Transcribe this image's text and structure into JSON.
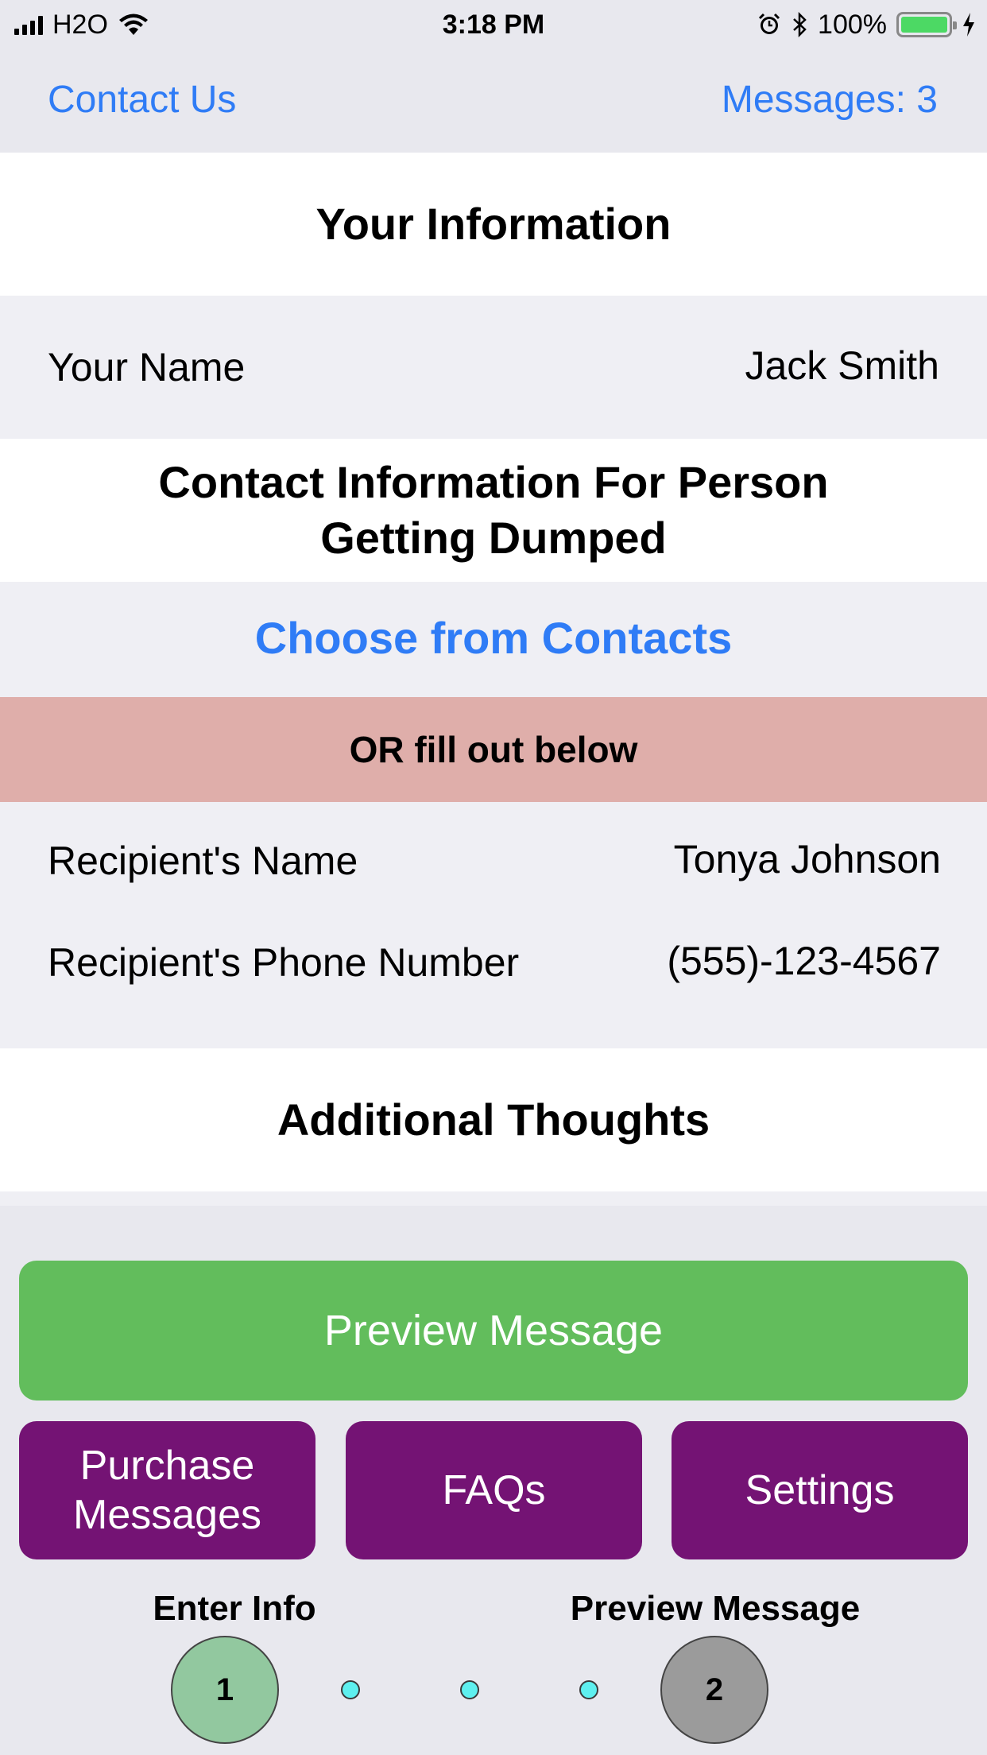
{
  "status_bar": {
    "carrier": "H2O",
    "time": "3:18 PM",
    "battery": "100%",
    "icons": [
      "signal-icon",
      "wifi-icon",
      "alarm-icon",
      "bluetooth-icon",
      "battery-icon",
      "charging-icon"
    ]
  },
  "nav": {
    "left_label": "Contact Us",
    "right_label": "Messages: 3"
  },
  "your_info": {
    "header": "Your Information",
    "name_label": "Your Name",
    "name_value": "Jack Smith"
  },
  "contact_info": {
    "header_line1": "Contact Information For Person",
    "header_line2": "Getting Dumped",
    "choose_label": "Choose from Contacts",
    "or_label": "OR fill out below",
    "recipient_name_label": "Recipient's Name",
    "recipient_name_value": "Tonya Johnson",
    "recipient_phone_label": "Recipient's Phone Number",
    "recipient_phone_value": "(555)-123-4567"
  },
  "additional": {
    "header": "Additional Thoughts"
  },
  "buttons": {
    "preview": "Preview Message",
    "purchase_line1": "Purchase",
    "purchase_line2": "Messages",
    "faqs": "FAQs",
    "settings": "Settings"
  },
  "progress": {
    "step1_label": "Enter Info",
    "step1_number": "1",
    "step2_label": "Preview Message",
    "step2_number": "2",
    "current_step": 1,
    "total_steps": 2
  },
  "colors": {
    "link": "#2f7cf6",
    "or_bar": "#dfaeaa",
    "preview_button": "#62bd5c",
    "action_button": "#741374",
    "step_active": "#92c89f",
    "step_inactive": "#9b9b9b",
    "dot": "#5ef0ef"
  }
}
